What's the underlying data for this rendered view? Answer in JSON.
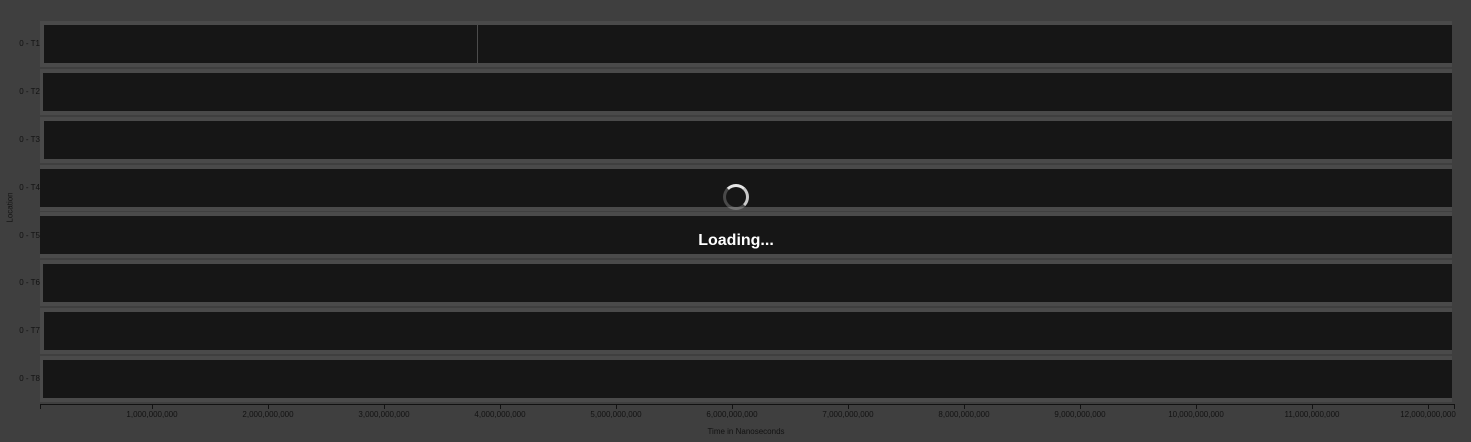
{
  "y_axis": {
    "title": "Location",
    "rows": [
      "0 - T1",
      "0 - T2",
      "0 - T3",
      "0 - T4",
      "0 - T5",
      "0 - T6",
      "0 - T7",
      "0 - T8"
    ]
  },
  "x_axis": {
    "title": "Time in Nanoseconds",
    "ticks": [
      "1,000,000,000",
      "2,000,000,000",
      "3,000,000,000",
      "4,000,000,000",
      "5,000,000,000",
      "6,000,000,000",
      "7,000,000,000",
      "8,000,000,000",
      "9,000,000,000",
      "10,000,000,000",
      "11,000,000,000",
      "12,000,000,000"
    ]
  },
  "loading": {
    "text": "Loading..."
  },
  "colors": {
    "background": "#3f3f3f",
    "lane": "#161616",
    "lane_band": "#4a4a4a",
    "text": "#121212",
    "overlay_text": "#ffffff"
  }
}
